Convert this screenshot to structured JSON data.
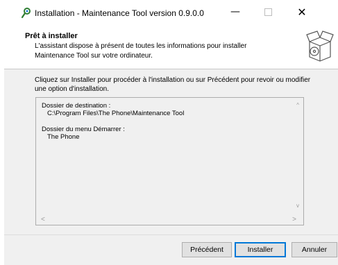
{
  "window": {
    "title": "Installation - Maintenance Tool version 0.9.0.0",
    "icons": {
      "app": "qt-installer-icon",
      "min": "minimize-icon",
      "max": "maximize-icon",
      "close": "close-icon"
    },
    "min_label": "—",
    "close_label": "✕"
  },
  "header": {
    "title": "Prêt à installer",
    "subtitle": "L'assistant dispose à présent de toutes les informations pour installer Maintenance Tool sur votre ordinateur.",
    "icon": "installer-box-icon"
  },
  "content": {
    "description": "Cliquez sur Installer pour procéder à l'installation ou sur Précédent pour revoir ou modifier une option d'installation.",
    "summary": {
      "dest_label": "Dossier de destination :",
      "dest_value": "C:\\Program Files\\The Phone\\Maintenance Tool",
      "menu_label": "Dossier du menu Démarrer :",
      "menu_value": "The Phone"
    },
    "scroll": {
      "up": "^",
      "down": "v",
      "left": "<",
      "right": ">"
    }
  },
  "buttons": {
    "previous": "Précédent",
    "install": "Installer",
    "cancel": "Annuler"
  },
  "colors": {
    "accent": "#0078d7",
    "content_bg": "#f0f0f0"
  }
}
